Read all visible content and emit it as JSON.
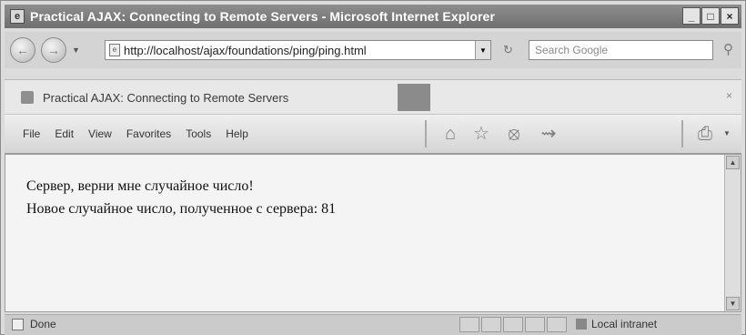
{
  "window": {
    "title": "Practical AJAX: Connecting to Remote Servers - Microsoft Internet Explorer",
    "controls": [
      "_",
      "□",
      "×"
    ]
  },
  "addressbar": {
    "url": "http://localhost/ajax/foundations/ping/ping.html",
    "search_placeholder": "Search Google"
  },
  "tab": {
    "label": "Practical AJAX: Connecting to Remote Servers",
    "close": "×"
  },
  "menu": {
    "items": [
      "File",
      "Edit",
      "View",
      "Favorites",
      "Tools",
      "Help"
    ]
  },
  "content": {
    "line1": "Сервер, верни мне случайное число!",
    "line2": "Новое случайное число, полученное с сервера: 81"
  },
  "status": {
    "text": "Done",
    "zone": "Local intranet"
  }
}
